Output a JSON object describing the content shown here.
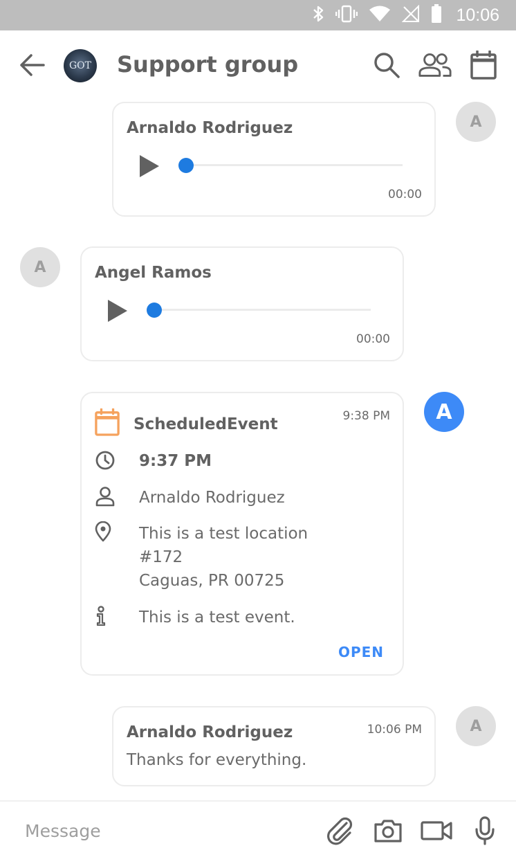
{
  "status_bar": {
    "time": "10:06",
    "icons": [
      "bluetooth-icon",
      "vibrate-icon",
      "wifi-icon",
      "no-signal-icon",
      "battery-icon"
    ]
  },
  "header": {
    "title": "Support group",
    "group_avatar_text": "GOT",
    "actions": [
      "search-icon",
      "members-icon",
      "calendar-icon"
    ]
  },
  "messages": [
    {
      "type": "audio",
      "side": "right",
      "sender": "Arnaldo Rodriguez",
      "avatar": "A",
      "duration": "00:00",
      "progress": 0
    },
    {
      "type": "audio",
      "side": "left",
      "sender": "Angel Ramos",
      "avatar": "A",
      "duration": "00:00",
      "progress": 0
    },
    {
      "type": "event",
      "side": "right",
      "avatar": "A",
      "title": "ScheduledEvent",
      "timestamp": "9:38 PM",
      "time": "9:37 PM",
      "organizer": "Arnaldo Rodriguez",
      "location_lines": [
        "This is a test location",
        "#172",
        "Caguas, PR 00725"
      ],
      "description": "This is a test event.",
      "action": "OPEN"
    },
    {
      "type": "text",
      "side": "right",
      "sender": "Arnaldo Rodriguez",
      "avatar": "A",
      "timestamp": "10:06 PM",
      "text": "Thanks for everything."
    }
  ],
  "composer": {
    "placeholder": "Message",
    "actions": [
      "attach-icon",
      "camera-icon",
      "video-icon",
      "mic-icon"
    ]
  },
  "colors": {
    "accent": "#3d8af7",
    "audio_knob": "#1e7be0",
    "event_icon": "#f5a25d",
    "status_bar": "#bdbdbd",
    "avatar_bg": "#e0e0e0"
  }
}
